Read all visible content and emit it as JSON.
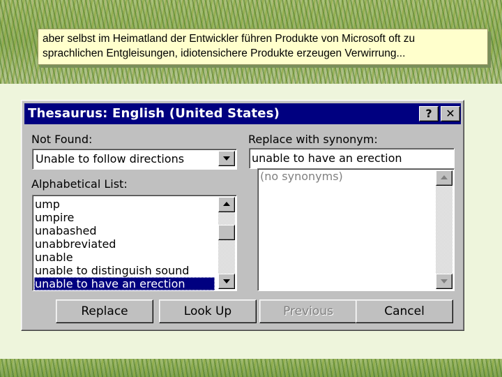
{
  "caption": {
    "line1": "aber selbst im Heimatland der Entwickler führen Produkte von Microsoft oft zu",
    "line2": "sprachlichen Entgleisungen, idiotensichere Produkte erzeugen Verwirrung..."
  },
  "dialog": {
    "title": "Thesaurus: English (United States)",
    "help_label": "?",
    "close_label": "✕",
    "not_found_label": "Not Found:",
    "not_found_value": "Unable to follow directions",
    "replace_label": "Replace with synonym:",
    "replace_value": "unable to have an erection",
    "alpha_label": "Alphabetical List:",
    "alpha_items": [
      "ump",
      "umpire",
      "unabashed",
      "unabbreviated",
      "unable",
      "unable to distinguish sound",
      "unable to have an erection"
    ],
    "synonyms_placeholder": "(no synonyms)",
    "buttons": {
      "replace": "Replace",
      "look_up": "Look Up",
      "previous": "Previous",
      "cancel": "Cancel"
    }
  },
  "colors": {
    "titlebar": "#000080",
    "dialog_face": "#c0c0c0",
    "caption_bg": "#ffffcc",
    "selection": "#000080"
  }
}
